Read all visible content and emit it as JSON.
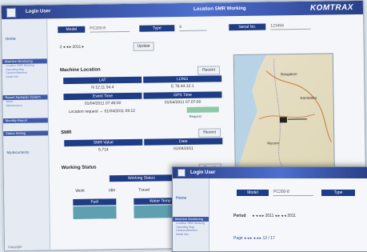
{
  "app": {
    "user_label": "Login User",
    "window_title": "Location SMR Working",
    "brand": "KOMTRAX"
  },
  "sidebar": {
    "home": "Home",
    "groups": [
      {
        "head": "Machine Monitoring",
        "links": [
          "Location SMR Working",
          "Operating Map",
          "Caution/Attention",
          "Detail Info"
        ]
      },
      {
        "head": "Report Hydraulic System",
        "links": [
          "Mode",
          "Maintenance"
        ]
      },
      {
        "head": "Monthly Report"
      },
      {
        "head": "Status Setting"
      }
    ],
    "extra": "Mydocuments"
  },
  "filters": {
    "model_label": "Model",
    "model_value": "PC200-8",
    "type_label": "Type",
    "type_value": "8",
    "serial_label": "Serial No.",
    "serial_value": "123456",
    "nav_text": "2  ◂  ◂  ▸  2011  ▸",
    "update_label": "Update"
  },
  "machine_location": {
    "title": "Machine Location",
    "lat_label": "LAT",
    "long_label": "LONG",
    "lat_value": "N 12.11.54.4",
    "long_value": "E 76.44.12.1",
    "event_label": "Event Time",
    "gps_label": "GPS Time",
    "event_value": "01/04/2011 07:48:00",
    "gps_value": "01/04/2011 07:07:00",
    "request_text": "Location request  →  01/04/2011 09:12",
    "request_button": "Request",
    "recent_button": "Recent"
  },
  "smr": {
    "title": "SMR",
    "value_label": "SMR Value",
    "date_label": "Date",
    "value": "5,714",
    "date": "01/04/2011",
    "recent_button": "Recent"
  },
  "working_status": {
    "title": "Working Status",
    "status_label": "Working Status",
    "recent_button": "Recent",
    "sub_values": [
      "Work",
      "Idle",
      "Travel"
    ],
    "fuel_label": "Fuel",
    "water_label": "Water Temp"
  },
  "map": {
    "labels": [
      "Bangalore",
      "Karnataka",
      "Mysore"
    ]
  },
  "popup": {
    "user_label": "Login User",
    "home": "Home",
    "group_head": "Machine Monitoring",
    "links": [
      "Location SMR Working",
      "Operating Map",
      "Caution/Attention",
      "Detail Info"
    ],
    "model_label": "Model",
    "model_value": "PC200-8",
    "type_label": "Type",
    "period_label": "Period",
    "period_nav": "▸  ◂  ◂  ▸  2011  ◂  ▸  ◂  ◂  2011",
    "bottom_nav": "Page  ◂  ◂  ▸  ◂  ◂  ▸  12 / 17"
  },
  "footer": "Copyright"
}
